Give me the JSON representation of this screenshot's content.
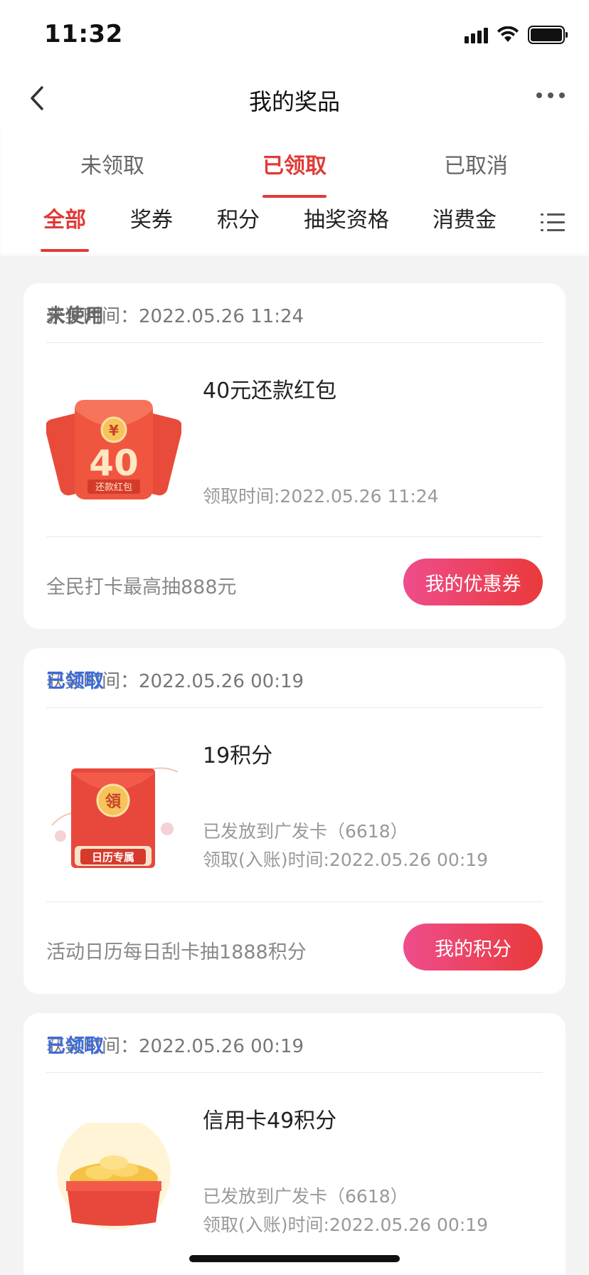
{
  "status_bar": {
    "time": "11:32"
  },
  "nav": {
    "title": "我的奖品"
  },
  "tabs_primary": [
    {
      "label": "未领取",
      "active": false
    },
    {
      "label": "已领取",
      "active": true
    },
    {
      "label": "已取消",
      "active": false
    }
  ],
  "tabs_secondary": [
    {
      "label": "全部",
      "active": true
    },
    {
      "label": "奖券",
      "active": false
    },
    {
      "label": "积分",
      "active": false
    },
    {
      "label": "抽奖资格",
      "active": false
    },
    {
      "label": "消费金",
      "active": false
    }
  ],
  "cards": [
    {
      "award_time_label": "获奖时间：2022.05.26 11:24",
      "status": "未使用",
      "name": "40元还款红包",
      "thumb_amount": "40",
      "thumb_caption": "还款红包",
      "thumb_symbol": "¥",
      "line1": "",
      "line2": "领取时间:2022.05.26 11:24",
      "promo": "全民打卡最高抽888元",
      "button": "我的优惠券"
    },
    {
      "award_time_label": "获奖时间：2022.05.26 00:19",
      "status": "已领取",
      "name": "19积分",
      "thumb_symbol": "領",
      "thumb_caption": "日历专属",
      "line1": "已发放到广发卡（6618）",
      "line2": "领取(入账)时间:2022.05.26 00:19",
      "promo": "活动日历每日刮卡抽1888积分",
      "button": "我的积分"
    },
    {
      "award_time_label": "获奖时间：2022.05.26 00:19",
      "status": "已领取",
      "name": "信用卡49积分",
      "line1": "已发放到广发卡（6618）",
      "line2": "领取(入账)时间:2022.05.26 00:19"
    }
  ],
  "colors": {
    "accent": "#e03a37",
    "status_blue": "#3a6be0",
    "status_grey": "#666666"
  }
}
